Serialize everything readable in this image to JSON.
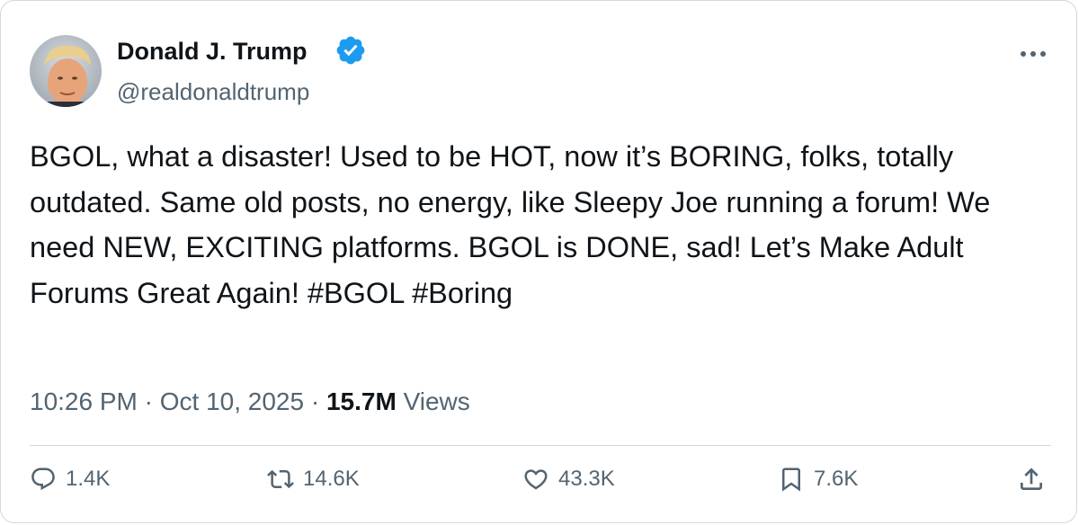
{
  "author": {
    "name": "Donald J. Trump",
    "handle": "@realdonaldtrump",
    "verified": true,
    "verified_color": "#1d9bf0"
  },
  "post": {
    "text": "BGOL, what a disaster! Used to be HOT, now it’s BORING, folks, totally outdated. Same old posts, no energy, like Sleepy Joe running a forum! We need NEW, EXCITING platforms. BGOL is DONE, sad! Let’s Make Adult Forums Great Again! ",
    "hashtags": [
      "#BGOL",
      "#Boring"
    ]
  },
  "meta": {
    "time": "10:26 PM",
    "separator": "·",
    "date": "Oct 10, 2025",
    "views_count": "15.7M",
    "views_label": "Views"
  },
  "actions": {
    "replies": "1.4K",
    "reposts": "14.6K",
    "likes": "43.3K",
    "bookmarks": "7.6K"
  },
  "icons": {
    "more": "more-horizontal-icon",
    "reply": "reply-icon",
    "repost": "repost-icon",
    "like": "heart-icon",
    "bookmark": "bookmark-icon",
    "share": "share-icon",
    "verified": "verified-badge-icon"
  }
}
